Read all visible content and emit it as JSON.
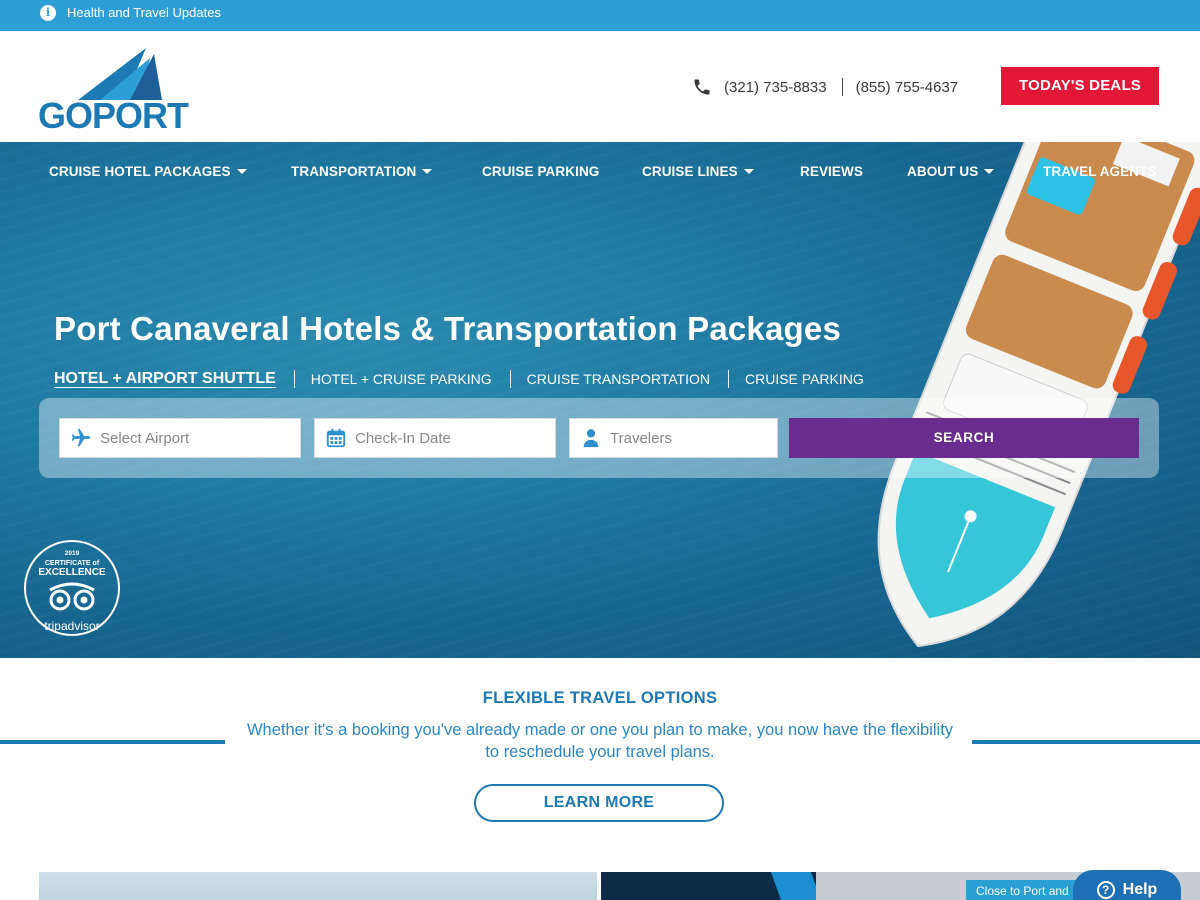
{
  "topbar": {
    "info_icon": "info-icon",
    "text": "Health and Travel Updates"
  },
  "header": {
    "logo_text": "GOPORT",
    "phone_icon": "phone-icon",
    "phone_1": "(321) 735-8833",
    "phone_2": "(855) 755-4637",
    "deals_button": "TODAY'S DEALS"
  },
  "nav": {
    "items": [
      {
        "label": "CRUISE HOTEL PACKAGES",
        "has_dropdown": true
      },
      {
        "label": "TRANSPORTATION",
        "has_dropdown": true
      },
      {
        "label": "CRUISE PARKING",
        "has_dropdown": false
      },
      {
        "label": "CRUISE LINES",
        "has_dropdown": true
      },
      {
        "label": "REVIEWS",
        "has_dropdown": false
      },
      {
        "label": "ABOUT US",
        "has_dropdown": true
      },
      {
        "label": "TRAVEL AGENTS",
        "has_dropdown": false
      }
    ]
  },
  "hero": {
    "title": "Port Canaveral Hotels & Transportation Packages",
    "tabs": [
      {
        "label": "HOTEL + AIRPORT SHUTTLE",
        "active": true
      },
      {
        "label": "HOTEL + CRUISE PARKING",
        "active": false
      },
      {
        "label": "CRUISE TRANSPORTATION",
        "active": false
      },
      {
        "label": "CRUISE PARKING",
        "active": false
      }
    ],
    "search": {
      "airport_placeholder": "Select Airport",
      "checkin_placeholder": "Check-In Date",
      "travelers_placeholder": "Travelers",
      "button": "SEARCH"
    },
    "badge": {
      "year": "2019",
      "line1": "CERTIFICATE of",
      "line2": "EXCELLENCE",
      "brand": "tripadvisor"
    }
  },
  "flexible": {
    "title": "FLEXIBLE TRAVEL OPTIONS",
    "text": "Whether it's a booking you've already made or one you plan to make, you now have the flexibility to reschedule your travel plans.",
    "button": "LEARN MORE"
  },
  "cards": {
    "right_tag": "Close to Port and"
  },
  "help": {
    "label": "Help"
  },
  "colors": {
    "topbar": "#2e9ed6",
    "brand_blue": "#1d79b4",
    "deals_red": "#e31837",
    "search_purple": "#6a2d8f"
  }
}
